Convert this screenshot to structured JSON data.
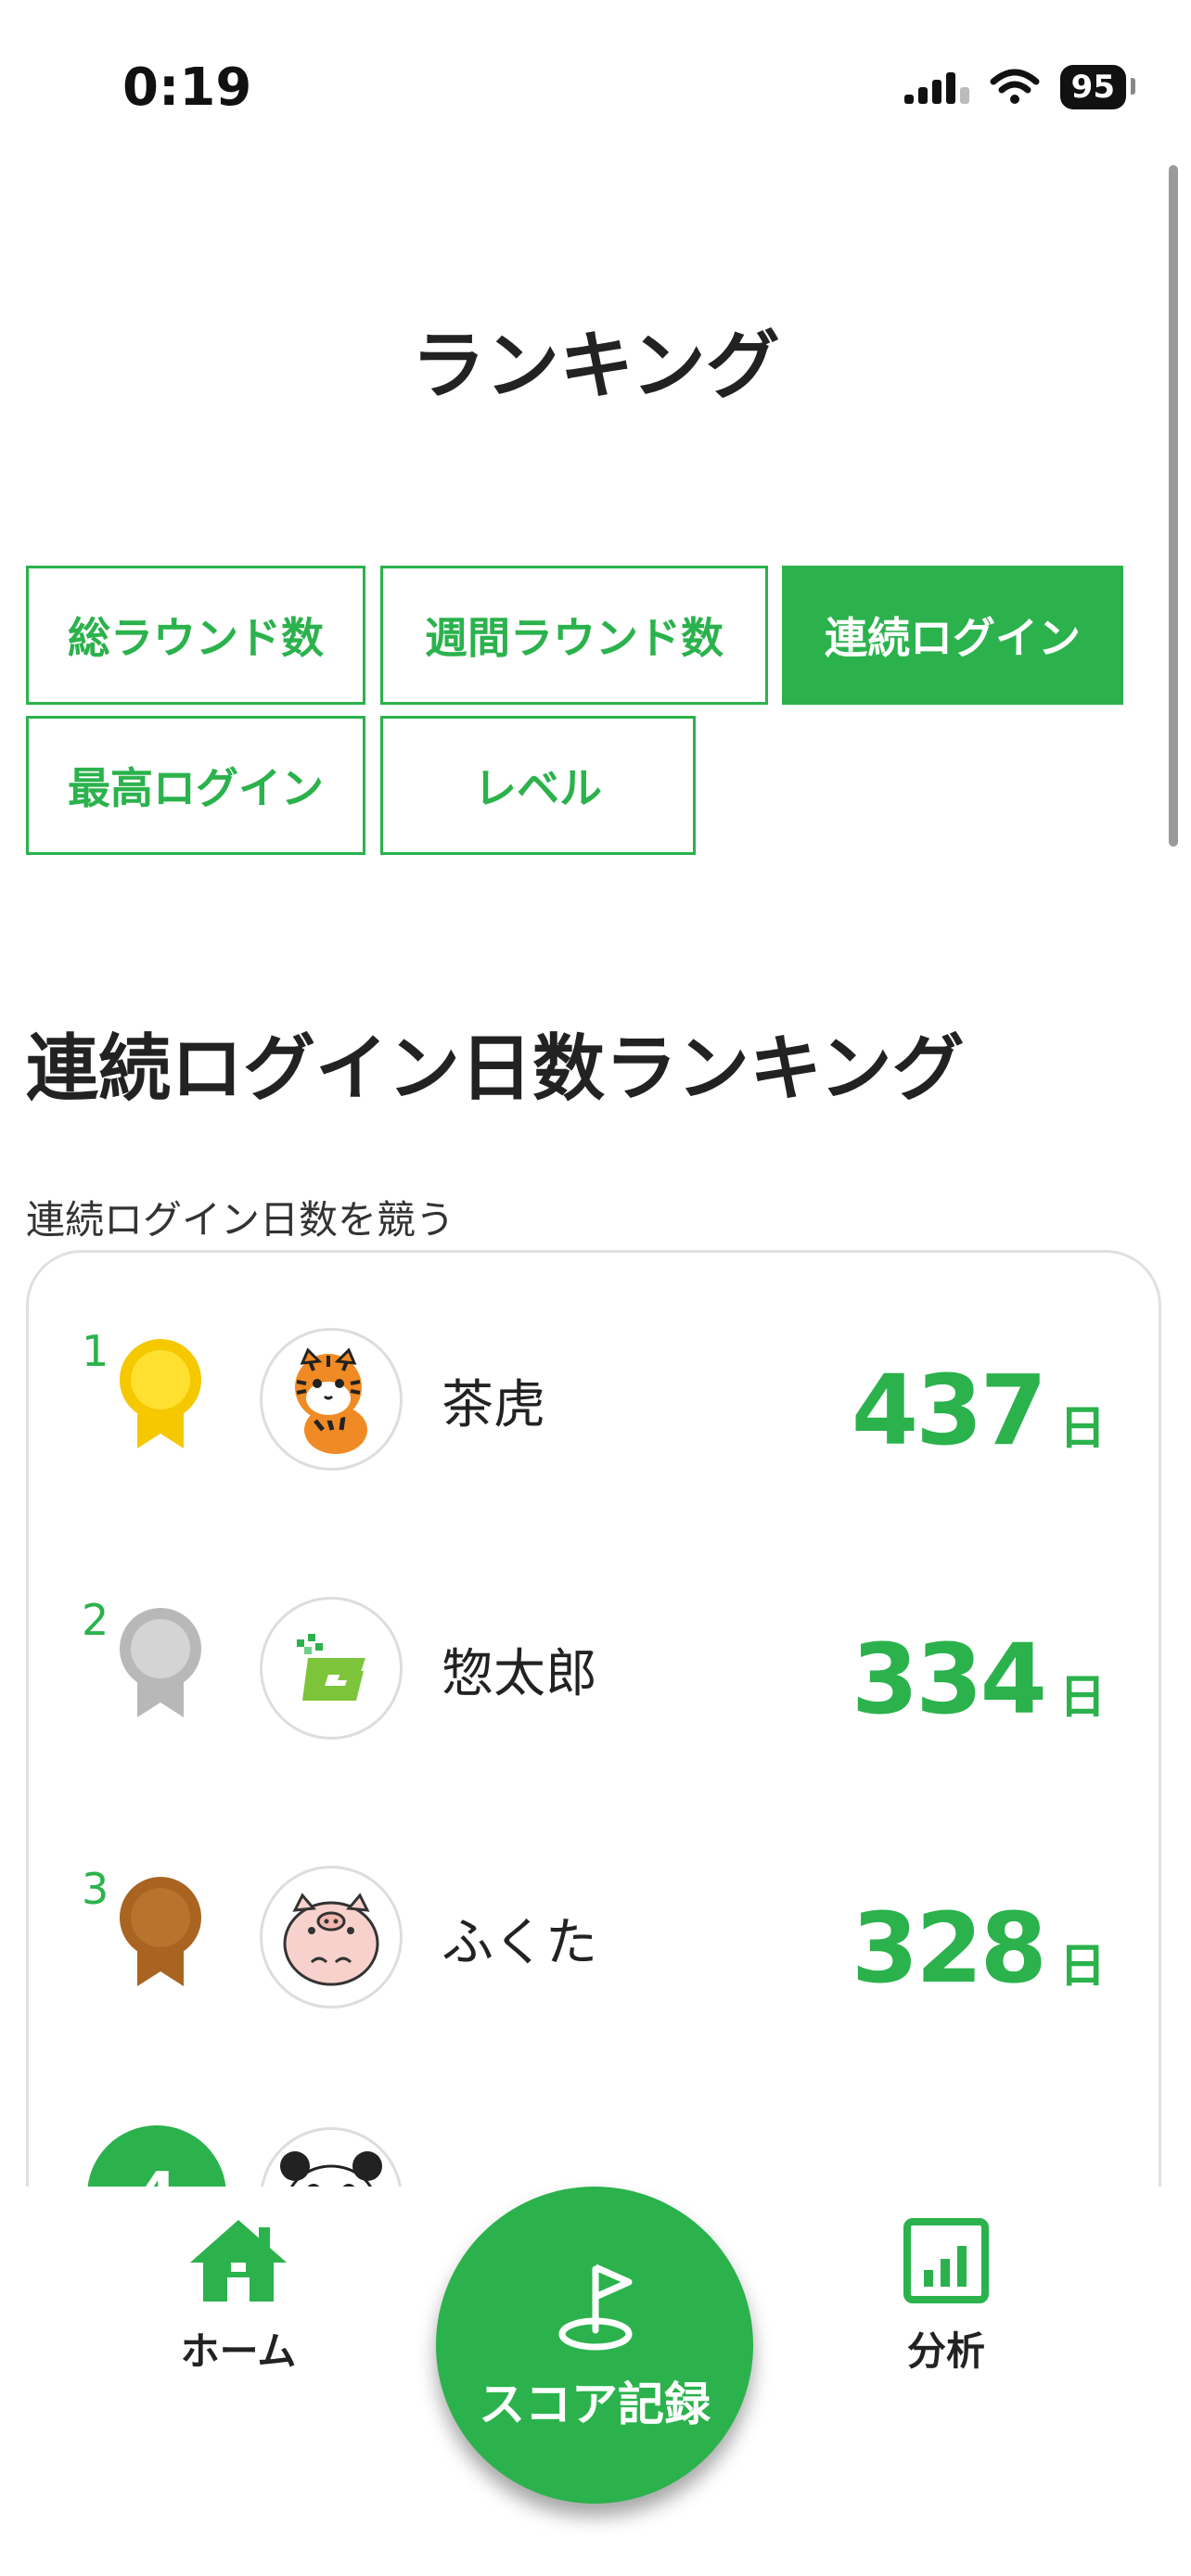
{
  "status_bar": {
    "time": "0:19",
    "battery": "95"
  },
  "page_title": "ランキング",
  "tabs": [
    {
      "label": "総ラウンド数",
      "active": false
    },
    {
      "label": "週間ラウンド数",
      "active": false
    },
    {
      "label": "連続ログイン",
      "active": true
    },
    {
      "label": "最高ログイン",
      "active": false
    },
    {
      "label": "レベル",
      "active": false
    }
  ],
  "section": {
    "title": "連続ログイン日数ランキング",
    "description": "連続ログイン日数を競う"
  },
  "rankings": [
    {
      "rank": "1",
      "name": "茶虎",
      "value": "437",
      "unit": "日",
      "medal": "gold-medal-icon",
      "avatar": "tiger-avatar-icon"
    },
    {
      "rank": "2",
      "name": "惣太郎",
      "value": "334",
      "unit": "日",
      "medal": "silver-medal-icon",
      "avatar": "g-logo-avatar-icon"
    },
    {
      "rank": "3",
      "name": "ふくた",
      "value": "328",
      "unit": "日",
      "medal": "bronze-medal-icon",
      "avatar": "pig-avatar-icon"
    },
    {
      "rank": "4",
      "name": "",
      "value": "",
      "unit": "",
      "medal": "",
      "avatar": "panda-avatar-icon"
    }
  ],
  "bottom_nav": {
    "home_label": "ホーム",
    "score_label": "スコア記録",
    "analysis_label": "分析"
  },
  "colors": {
    "accent": "#2bb24c",
    "gold": "#f5d000",
    "silver": "#b8b8b8",
    "bronze": "#a86420"
  }
}
